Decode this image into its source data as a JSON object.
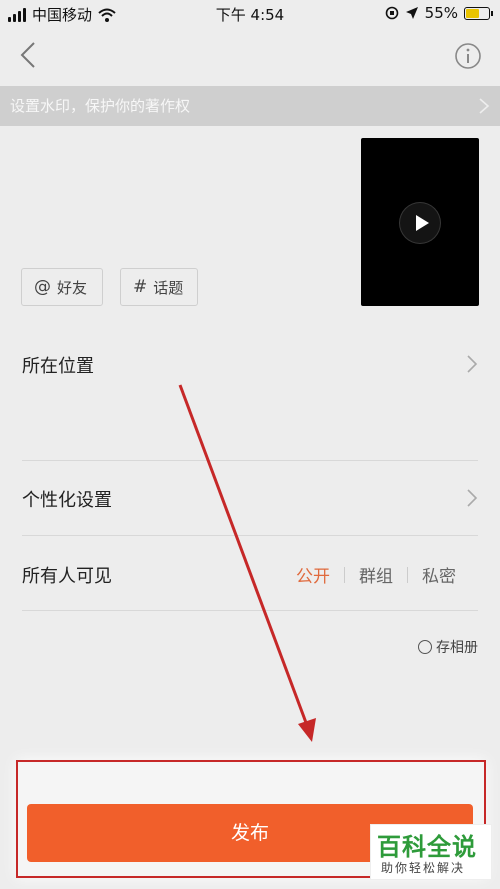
{
  "status_bar": {
    "carrier": "中国移动",
    "time": "下午 4:54",
    "battery": "55%"
  },
  "banner": {
    "text": "设置水印，保护你的著作权"
  },
  "chips": [
    {
      "symbol": "@",
      "label": "好友"
    },
    {
      "symbol": "#",
      "label": "话题"
    }
  ],
  "rows": {
    "location": "所在位置",
    "personalize": "个性化设置",
    "visibility": "所有人可见"
  },
  "privacy_options": [
    "公开",
    "群组",
    "私密"
  ],
  "save_album": "存相册",
  "publish_label": "发布",
  "watermark": {
    "big": "百科全说",
    "small": "助你轻松解决"
  },
  "colors": {
    "accent": "#f15f2b",
    "active_option": "#e06a3d",
    "annotation": "#c62828"
  }
}
